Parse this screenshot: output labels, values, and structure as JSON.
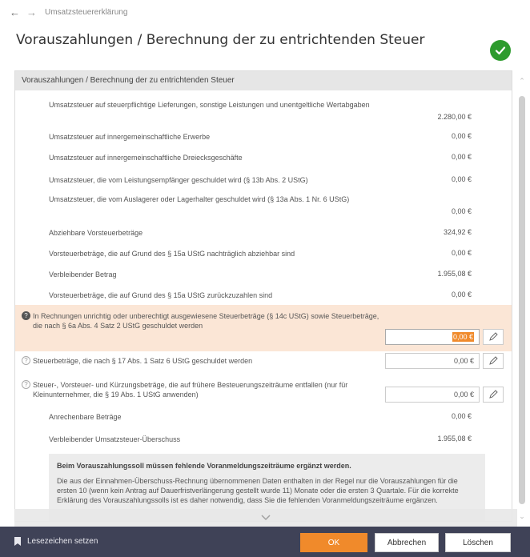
{
  "nav": {
    "breadcrumb": "Umsatzsteuererklärung"
  },
  "page": {
    "title": "Vorauszahlungen / Berechnung der zu entrichtenden Steuer"
  },
  "panel": {
    "header": "Vorauszahlungen / Berechnung der zu entrichtenden Steuer",
    "rows": [
      {
        "label": "Umsatzsteuer auf steuerpflichtige Lieferungen, sonstige Leistungen und unentgeltliche Wertabgaben",
        "value": "2.280,00 €"
      },
      {
        "label": "Umsatzsteuer auf innergemeinschaftliche Erwerbe",
        "value": "0,00 €"
      },
      {
        "label": "Umsatzsteuer auf innergemeinschaftliche Dreiecksgeschäfte",
        "value": "0,00 €"
      },
      {
        "label": "Umsatzsteuer, die vom Leistungsempfänger geschuldet wird (§ 13b Abs. 2 UStG)",
        "value": "0,00 €"
      },
      {
        "label": "Umsatzsteuer, die vom Auslagerer oder Lagerhalter geschuldet wird (§ 13a Abs. 1 Nr. 6 UStG)",
        "value": "0,00 €"
      },
      {
        "label": "Abziehbare Vorsteuerbeträge",
        "value": "324,92 €"
      },
      {
        "label": "Vorsteuerbeträge, die auf Grund des § 15a UStG nachträglich abziehbar sind",
        "value": "0,00 €"
      },
      {
        "label": "Verbleibender Betrag",
        "value": "1.955,08 €"
      },
      {
        "label": "Vorsteuerbeträge, die auf Grund des § 15a UStG zurückzuzahlen sind",
        "value": "0,00 €"
      }
    ],
    "inputs": [
      {
        "label": "In Rechnungen unrichtig oder unberechtigt ausgewiesene Steuerbeträge (§ 14c UStG) sowie Steuerbeträge, die nach § 6a Abs. 4 Satz 2 UStG geschuldet werden",
        "value": "0,00 €"
      },
      {
        "label": "Steuerbeträge, die nach § 17 Abs. 1 Satz 6 UStG geschuldet werden",
        "value": "0,00 €"
      },
      {
        "label": "Steuer-, Vorsteuer- und Kürzungsbeträge, die auf frühere Besteuerungszeiträume entfallen (nur für Kleinunternehmer, die § 19 Abs. 1 UStG anwenden)",
        "value": "0,00 €"
      }
    ],
    "after": [
      {
        "label": "Anrechenbare Beträge",
        "value": "0,00 €"
      },
      {
        "label": "Verbleibender Umsatzsteuer-Überschuss",
        "value": "1.955,08 €"
      }
    ],
    "info": {
      "heading": "Beim Vorauszahlungssoll müssen fehlende Voranmeldungszeiträume ergänzt werden.",
      "text": "Die aus der Einnahmen-Überschuss-Rechnung übernommenen Daten enthalten in der Regel nur die Vorauszahlungen für die ersten 10 (wenn kein Antrag auf Dauerfristverlängerung gestellt wurde 11) Monate oder die ersten 3 Quartale. Für die korrekte Erklärung des Vorauszahlungssolls ist es daher notwendig, dass Sie die fehlenden Voranmeldungszeiträume ergänzen."
    }
  },
  "footer": {
    "bookmark": "Lesezeichen setzen",
    "ok": "OK",
    "cancel": "Abbrechen",
    "delete": "Löschen"
  },
  "colors": {
    "accent": "#f08a2b",
    "footer": "#3f4257",
    "success": "#2d9b2d",
    "highlight": "#fbe6d6"
  }
}
